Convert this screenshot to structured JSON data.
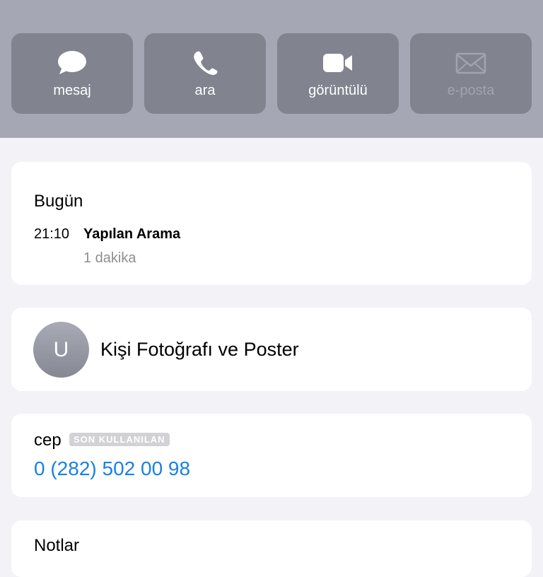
{
  "actions": {
    "message": {
      "label": "mesaj",
      "icon": "message-bubble-icon"
    },
    "call": {
      "label": "ara",
      "icon": "phone-icon"
    },
    "video": {
      "label": "görüntülü",
      "icon": "video-camera-icon"
    },
    "email": {
      "label": "e-posta",
      "icon": "envelope-icon",
      "disabled": true
    }
  },
  "recent": {
    "day": "Bugün",
    "time": "21:10",
    "type": "Yapılan Arama",
    "duration": "1 dakika"
  },
  "photo": {
    "avatar_initial": "U",
    "label": "Kişi Fotoğrafı ve Poster"
  },
  "phone": {
    "label": "cep",
    "badge": "SON KULLANILAN",
    "number": "0 (282) 502 00 98"
  },
  "notes": {
    "label": "Notlar"
  },
  "colors": {
    "header_bg": "#a5a7b4",
    "button_bg": "#81838f",
    "link": "#1a80e5",
    "background": "#f2f2f7"
  }
}
